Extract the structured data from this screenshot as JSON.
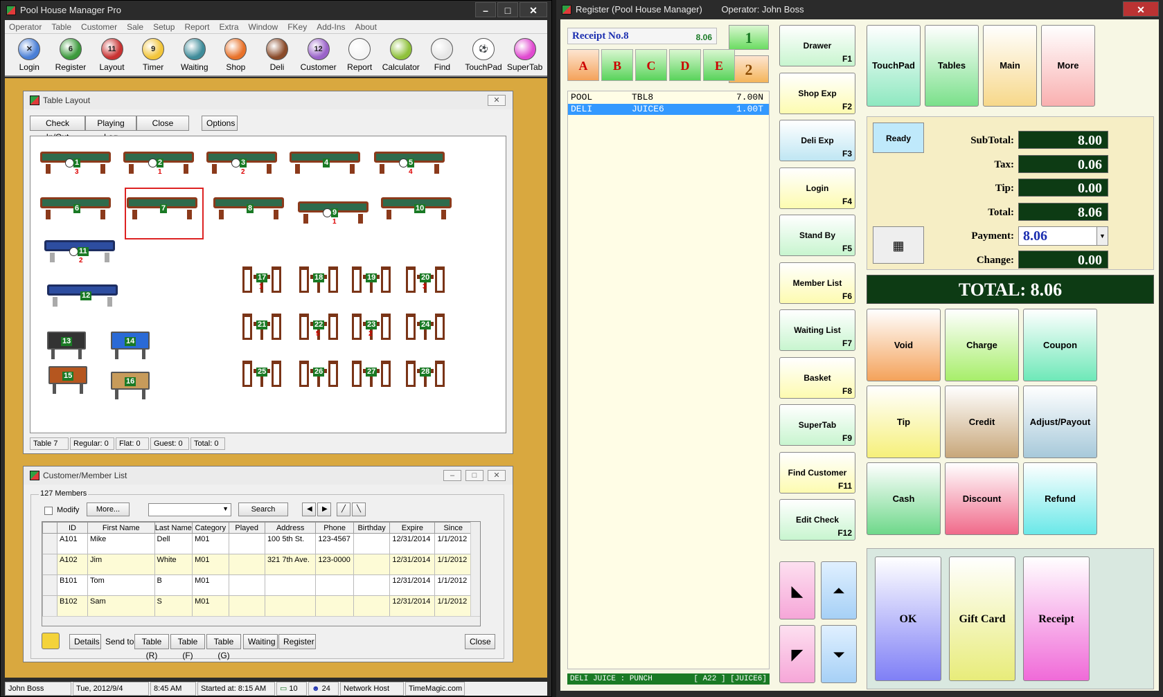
{
  "left_window": {
    "title": "Pool House Manager Pro",
    "menu": [
      "Operator",
      "Table",
      "Customer",
      "Sale",
      "Setup",
      "Report",
      "Extra",
      "Window",
      "FKey",
      "Add-Ins",
      "About"
    ],
    "tools": [
      {
        "label": "Login",
        "icon": "login-icon",
        "color": "#4a7fd6",
        "glyph": "✕"
      },
      {
        "label": "Register",
        "icon": "register-ball-icon",
        "color": "#3c9a3c",
        "glyph": "6"
      },
      {
        "label": "Layout",
        "icon": "layout-ball-icon",
        "color": "#c83232",
        "glyph": "11"
      },
      {
        "label": "Timer",
        "icon": "timer-ball-icon",
        "color": "#f2c53a",
        "glyph": "9"
      },
      {
        "label": "Waiting",
        "icon": "bowling-ball-icon",
        "color": "#3f8c9a",
        "glyph": ""
      },
      {
        "label": "Shop",
        "icon": "basketball-icon",
        "color": "#e8722a",
        "glyph": ""
      },
      {
        "label": "Deli",
        "icon": "football-icon",
        "color": "#8a4b2a",
        "glyph": ""
      },
      {
        "label": "Customer",
        "icon": "customer-ball-icon",
        "color": "#9a63c9",
        "glyph": "12"
      },
      {
        "label": "Report",
        "icon": "baseball-icon",
        "color": "#f4f4f4",
        "glyph": ""
      },
      {
        "label": "Calculator",
        "icon": "tennis-ball-icon",
        "color": "#8fc13a",
        "glyph": ""
      },
      {
        "label": "Find",
        "icon": "golf-ball-icon",
        "color": "#e6e6e6",
        "glyph": ""
      },
      {
        "label": "TouchPad",
        "icon": "soccer-ball-icon",
        "color": "#ffffff",
        "glyph": "⚽"
      },
      {
        "label": "SuperTab",
        "icon": "color-wheel-icon",
        "color": "#e04ad0",
        "glyph": ""
      }
    ],
    "table_layout": {
      "title": "Table Layout",
      "buttons": [
        "Check In/Out",
        "Playing Log",
        "Close",
        "Options"
      ],
      "pool_tables": [
        {
          "num": "1",
          "red": "3",
          "timer": true
        },
        {
          "num": "2",
          "red": "1",
          "timer": true
        },
        {
          "num": "3",
          "red": "2",
          "timer": true
        },
        {
          "num": "4",
          "red": "",
          "timer": false
        },
        {
          "num": "5",
          "red": "4",
          "timer": true
        },
        {
          "num": "6",
          "red": "",
          "timer": false
        },
        {
          "num": "7",
          "red": "",
          "timer": false
        },
        {
          "num": "8",
          "red": "",
          "timer": false
        },
        {
          "num": "9",
          "red": "1",
          "timer": true
        },
        {
          "num": "10",
          "red": "",
          "timer": false
        },
        {
          "num": "11",
          "red": "2",
          "timer": true
        },
        {
          "num": "12",
          "red": "",
          "timer": false
        }
      ],
      "games": [
        "13",
        "14",
        "15",
        "16"
      ],
      "seat_tables": [
        {
          "num": "17",
          "red": "1"
        },
        {
          "num": "18",
          "red": ""
        },
        {
          "num": "19",
          "red": ""
        },
        {
          "num": "20",
          "red": "3"
        },
        {
          "num": "21",
          "red": ""
        },
        {
          "num": "22",
          "red": "5"
        },
        {
          "num": "23",
          "red": "2"
        },
        {
          "num": "24",
          "red": ""
        },
        {
          "num": "25",
          "red": ""
        },
        {
          "num": "26",
          "red": ""
        },
        {
          "num": "27",
          "red": ""
        },
        {
          "num": "28",
          "red": ""
        }
      ],
      "status": [
        "Table 7",
        "Regular: 0",
        "Flat: 0",
        "Guest: 0",
        "Total: 0"
      ]
    },
    "member_list": {
      "title": "Customer/Member List",
      "count": "127 Members",
      "modify_label": "Modify",
      "more_label": "More...",
      "search_label": "Search",
      "columns": [
        "ID",
        "First Name",
        "Last Name",
        "Category",
        "Played",
        "Address",
        "Phone",
        "Birthday",
        "Expire",
        "Since"
      ],
      "rows": [
        [
          "A101",
          "Mike",
          "Dell",
          "M01",
          "",
          "100 5th St.",
          "123-4567",
          "",
          "12/31/2014",
          "1/1/2012"
        ],
        [
          "A102",
          "Jim",
          "White",
          "M01",
          "",
          "321 7th Ave.",
          "123-0000",
          "",
          "12/31/2014",
          "1/1/2012"
        ],
        [
          "B101",
          "Tom",
          "B",
          "M01",
          "",
          "",
          "",
          "",
          "12/31/2014",
          "1/1/2012"
        ],
        [
          "B102",
          "Sam",
          "S",
          "M01",
          "",
          "",
          "",
          "",
          "12/31/2014",
          "1/1/2012"
        ]
      ],
      "bottom_buttons": [
        "Details"
      ],
      "send_to_label": "Send to",
      "send_buttons": [
        "Table (R)",
        "Table (F)",
        "Table (G)",
        "Waiting",
        "Register"
      ],
      "close_label": "Close"
    },
    "statusbar": [
      "John Boss",
      "Tue, 2012/9/4",
      "8:45 AM",
      "Started at: 8:15 AM",
      "10",
      "24",
      "Network Host",
      "TimeMagic.com"
    ]
  },
  "register": {
    "title": "Register (Pool House Manager)",
    "operator": "Operator: John Boss",
    "receipt_label": "Receipt No.8",
    "receipt_total": "8.06",
    "num_buttons": [
      "1",
      "2"
    ],
    "letters": [
      "A",
      "B",
      "C",
      "D",
      "E"
    ],
    "lines": [
      {
        "cat": "POOL",
        "item": "TBL8",
        "amt": "7.00N"
      },
      {
        "cat": "DELI",
        "item": "JUICE6",
        "amt": "1.00T"
      }
    ],
    "bottom_line": "DELI  JUICE : PUNCH",
    "bottom_code": "[ A22  ] [JUICE6]",
    "fkeys": [
      {
        "label": "Drawer",
        "key": "F1"
      },
      {
        "label": "Shop Exp",
        "key": "F2"
      },
      {
        "label": "Deli Exp",
        "key": "F3"
      },
      {
        "label": "Login",
        "key": "F4"
      },
      {
        "label": "Stand By",
        "key": "F5"
      },
      {
        "label": "Member List",
        "key": "F6"
      },
      {
        "label": "Waiting List",
        "key": "F7"
      },
      {
        "label": "Basket",
        "key": "F8"
      },
      {
        "label": "SuperTab",
        "key": "F9"
      },
      {
        "label": "Find Customer",
        "key": "F11"
      },
      {
        "label": "Edit Check",
        "key": "F12"
      }
    ],
    "top_buttons": [
      "TouchPad",
      "Tables",
      "Main",
      "More"
    ],
    "ready_label": "Ready",
    "subtotal_label": "SubTotal:",
    "subtotal": "8.00",
    "tax_label": "Tax:",
    "tax": "0.06",
    "tip_label": "Tip:",
    "tip": "0.00",
    "total_label": "Total:",
    "total": "8.06",
    "payment_label": "Payment:",
    "payment": "8.06",
    "change_label": "Change:",
    "change": "0.00",
    "grand_total": "TOTAL: 8.06",
    "actions": [
      "Void",
      "Charge",
      "Coupon",
      "Tip",
      "Credit",
      "Adjust/Payout",
      "Cash",
      "Discount",
      "Refund"
    ],
    "finals": [
      "OK",
      "Gift Card",
      "Receipt"
    ],
    "colors": {
      "green_display": "#0d3b14",
      "accent_blue": "#3399ff"
    }
  }
}
